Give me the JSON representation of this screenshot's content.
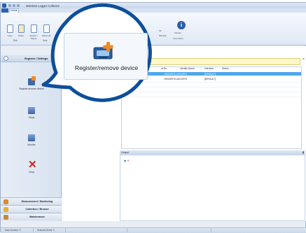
{
  "window": {
    "title": "Wireless Logger Collector",
    "file_tab": "",
    "tabs": [
      {
        "label": "Home"
      }
    ]
  },
  "ribbon": {
    "buttons": [
      {
        "label": "Copy"
      },
      {
        "label": "Paste"
      },
      {
        "label": "Search / Select"
      },
      {
        "label": "Select All"
      }
    ],
    "groups": [
      {
        "label": "Edit"
      },
      {
        "label": "Sele"
      }
    ],
    "window_group": {
      "line1": "Fit",
      "line2": "Window"
    },
    "info_button": {
      "label": "Version"
    },
    "info_group": {
      "label": "Information"
    }
  },
  "left_panel": {
    "title": "Register / Settings",
    "items": [
      {
        "label": "Register/remove device",
        "icon": "register-device-icon"
      },
      {
        "label": "Setup",
        "icon": "setup-icon"
      },
      {
        "label": "Monitor",
        "icon": "monitor-icon"
      },
      {
        "label": "Clear",
        "icon": "clear-icon"
      }
    ],
    "categories": [
      {
        "label": "Measurement / Monitoring",
        "icon": "measurement-icon"
      },
      {
        "label": "Collection / Browse",
        "icon": "collection-icon"
      },
      {
        "label": "Maintenance",
        "icon": "maintenance-icon"
      }
    ]
  },
  "content": {
    "location_label": ": Computer",
    "grid": {
      "headers": [
        "al No.",
        "Identify Name",
        "Interface",
        "Status"
      ],
      "rows": [
        [
          "",
          "LR0220974  UAC22974",
          "[DEFAULT]",
          ""
        ],
        [
          "",
          "LR0220976  UAC22976",
          "[DEFAULT]",
          ""
        ]
      ]
    },
    "output": {
      "label": "Output"
    }
  },
  "status_bar": {
    "serial_label": "Data Number: 0",
    "selected_label": "Selected Items: 0"
  },
  "callout": {
    "label": "Register/remove device",
    "icon": "register-device-icon",
    "colors": {
      "ring": "#0d4f9a",
      "accent": "#f08a24"
    }
  }
}
